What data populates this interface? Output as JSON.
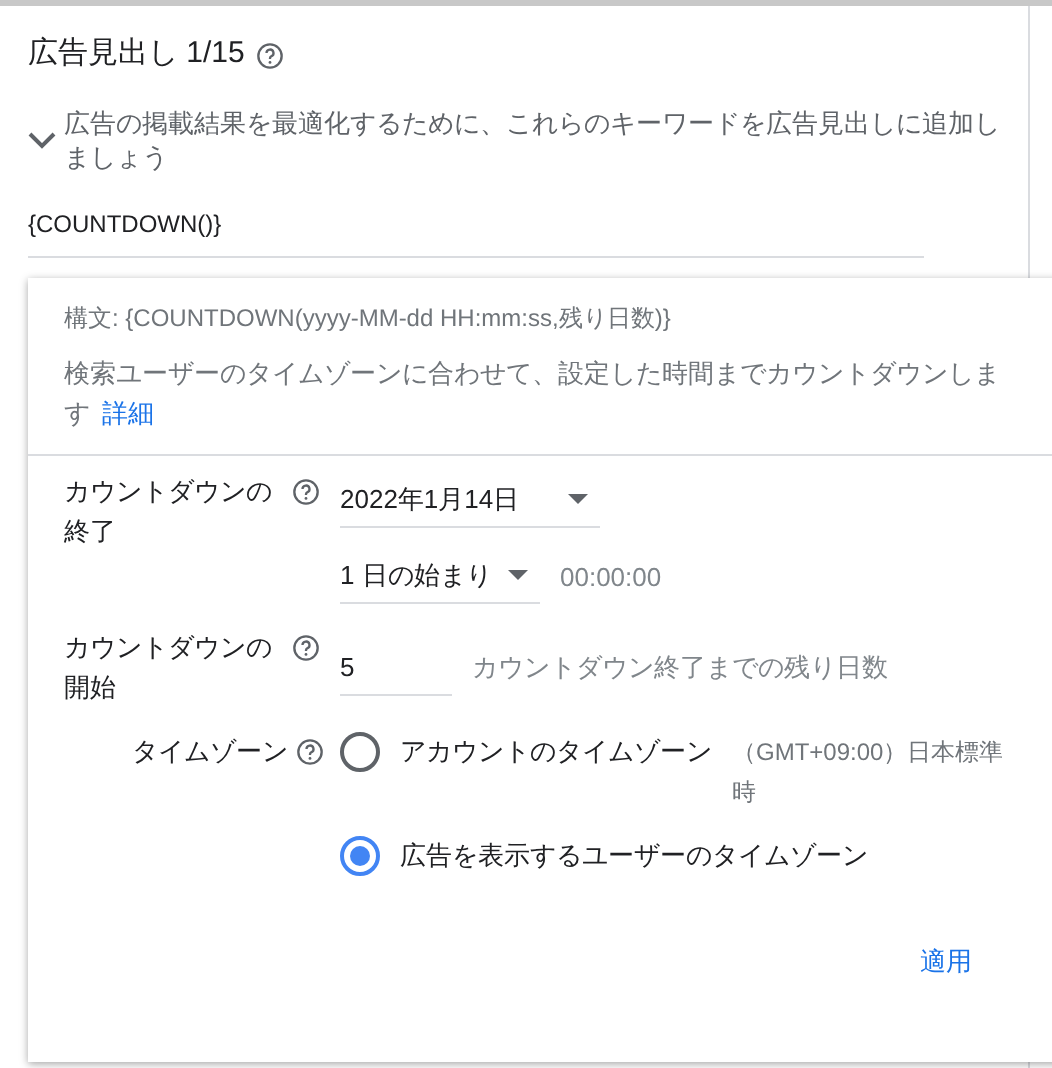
{
  "header": {
    "title": "広告見出し 1/15"
  },
  "suggestion": {
    "text": "広告の掲載結果を最適化するために、これらのキーワードを広告見出しに追加しましょう",
    "expanded": true
  },
  "headline_input": {
    "value": "{COUNTDOWN()}"
  },
  "popup": {
    "syntax": "構文: {COUNTDOWN(yyyy-MM-dd HH:mm:ss,残り日数)}",
    "description": "検索ユーザーのタイムゾーンに合わせて、設定した時間までカウントダウンします",
    "details_link": "詳細",
    "end": {
      "label": "カウントダウンの終了",
      "date": "2022年1月14日",
      "time_of_day": "1 日の始まり",
      "time": "00:00:00"
    },
    "start": {
      "label": "カウントダウンの開始",
      "days": "5",
      "hint": "カウントダウン終了までの残り日数"
    },
    "timezone": {
      "label": "タイムゾーン",
      "options": [
        {
          "label": "アカウントのタイムゾーン",
          "detail": "（GMT+09:00）日本標準時",
          "selected": false
        },
        {
          "label": "広告を表示するユーザーのタイムゾーン",
          "selected": true
        }
      ]
    },
    "apply_button": "適用"
  }
}
